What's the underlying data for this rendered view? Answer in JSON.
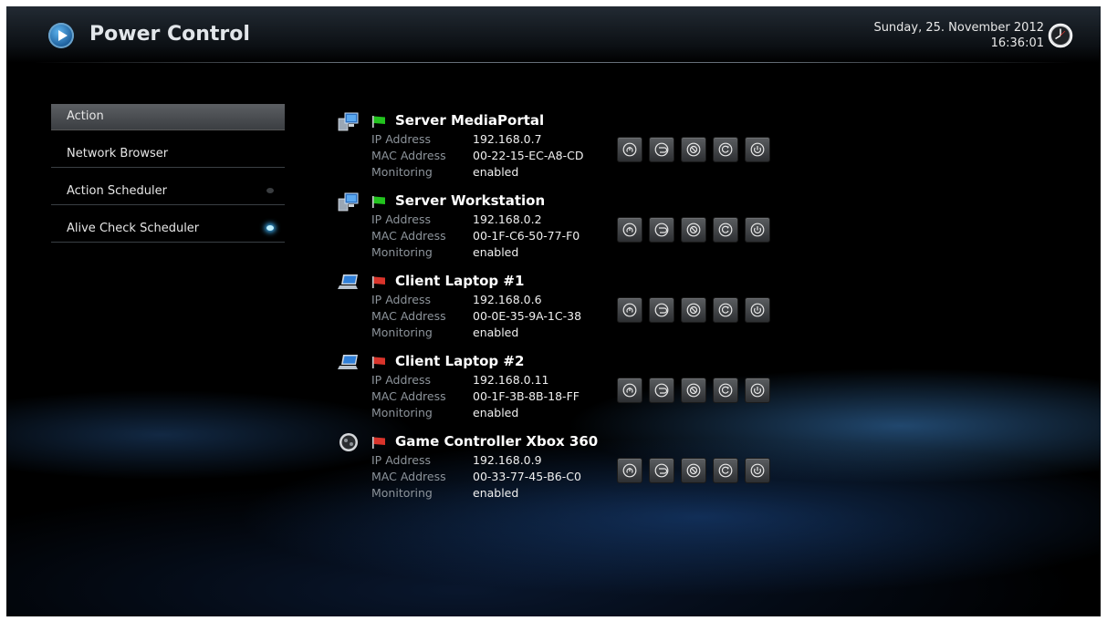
{
  "header": {
    "title": "Power Control",
    "date": "Sunday, 25. November 2012",
    "time": "16:36:01"
  },
  "menu": [
    {
      "label": "Action",
      "selected": true,
      "indicator": "none"
    },
    {
      "label": "Network Browser",
      "selected": false,
      "indicator": "none"
    },
    {
      "label": "Action Scheduler",
      "selected": false,
      "indicator": "off"
    },
    {
      "label": "Alive Check Scheduler",
      "selected": false,
      "indicator": "on"
    }
  ],
  "labels": {
    "ip": "IP Address",
    "mac": "MAC Address",
    "monitoring": "Monitoring"
  },
  "devices": [
    {
      "name": "Server MediaPortal",
      "type": "server-icon",
      "status": "online",
      "ip": "192.168.0.7",
      "mac": "00-22-15-EC-A8-CD",
      "monitoring": "enabled"
    },
    {
      "name": "Server Workstation",
      "type": "server-icon",
      "status": "online",
      "ip": "192.168.0.2",
      "mac": "00-1F-C6-50-77-F0",
      "monitoring": "enabled"
    },
    {
      "name": "Client Laptop #1",
      "type": "laptop-icon",
      "status": "offline",
      "ip": "192.168.0.6",
      "mac": "00-0E-35-9A-1C-38",
      "monitoring": "enabled"
    },
    {
      "name": "Client Laptop #2",
      "type": "laptop-icon",
      "status": "offline",
      "ip": "192.168.0.11",
      "mac": "00-1F-3B-8B-18-FF",
      "monitoring": "enabled"
    },
    {
      "name": "Game Controller Xbox 360",
      "type": "gamepad-icon",
      "status": "offline",
      "ip": "192.168.0.9",
      "mac": "00-33-77-45-B6-C0",
      "monitoring": "enabled"
    }
  ],
  "actions": [
    "power-on-icon",
    "hibernate-icon",
    "suspend-icon",
    "reboot-icon",
    "shutdown-icon"
  ],
  "colors": {
    "online": "#22c31e",
    "offline": "#d9342b",
    "accent": "#3fb8ff"
  }
}
